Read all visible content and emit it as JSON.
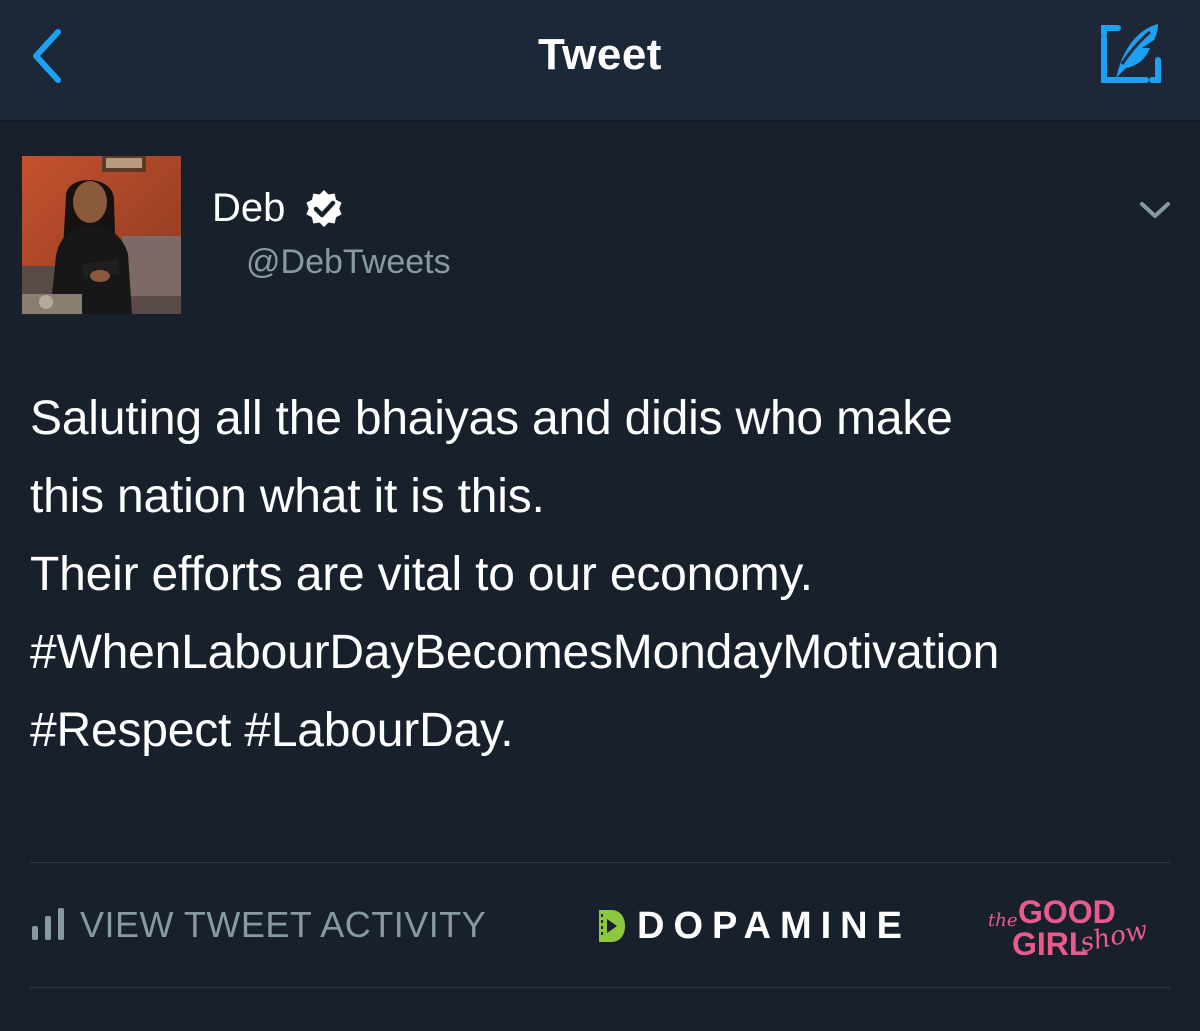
{
  "header": {
    "title": "Tweet",
    "back_icon": "chevron-left-icon",
    "compose_icon": "compose-quill-icon",
    "accent_color": "#1da1f2"
  },
  "tweet": {
    "author": {
      "name": "Deb",
      "handle": "@DebTweets",
      "verified": true
    },
    "text_lines": [
      "Saluting all the bhaiyas and didis who make",
      "this nation what it is this.",
      "Their efforts are vital to our economy.",
      "#WhenLabourDayBecomesMondayMotivation",
      "#Respect #LabourDay."
    ]
  },
  "footer": {
    "activity_label": "VIEW TWEET ACTIVITY",
    "activity_icon": "bar-chart-icon",
    "dopamine_label": "DOPAMINE",
    "dopamine_color": "#8dc63f",
    "ggs": {
      "the": "the",
      "good": "GOOD",
      "girl": "GIRL",
      "show": "show",
      "color": "#e85b8c"
    }
  },
  "colors": {
    "background": "#17202b",
    "header_background": "#1c2838",
    "secondary_text": "#8899a6"
  }
}
